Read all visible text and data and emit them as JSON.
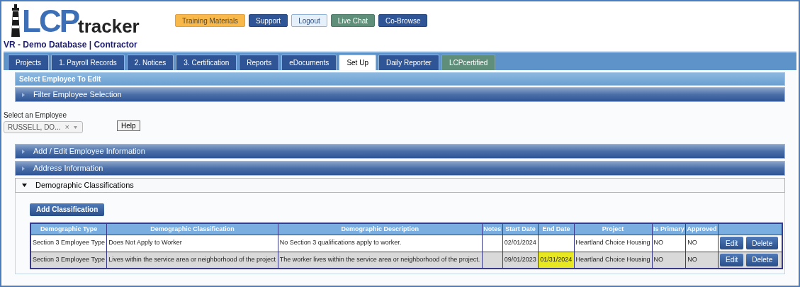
{
  "logo": {
    "mark": "LCP",
    "word": "tracker"
  },
  "subtitle": "VR - Demo Database | Contractor",
  "header_buttons": [
    {
      "label": "Training Materials",
      "kind": "training"
    },
    {
      "label": "Support",
      "kind": "primary"
    },
    {
      "label": "Logout",
      "kind": "light"
    },
    {
      "label": "Live Chat",
      "kind": "chat"
    },
    {
      "label": "Co-Browse",
      "kind": "primary"
    }
  ],
  "tabs": [
    {
      "label": "Projects",
      "selected": false,
      "kind": "normal"
    },
    {
      "label": "1. Payroll Records",
      "selected": false,
      "kind": "normal"
    },
    {
      "label": "2. Notices",
      "selected": false,
      "kind": "normal"
    },
    {
      "label": "3. Certification",
      "selected": false,
      "kind": "normal"
    },
    {
      "label": "Reports",
      "selected": false,
      "kind": "normal"
    },
    {
      "label": "eDocuments",
      "selected": false,
      "kind": "normal"
    },
    {
      "label": "Set Up",
      "selected": true,
      "kind": "normal"
    },
    {
      "label": "Daily Reporter",
      "selected": false,
      "kind": "normal"
    },
    {
      "label": "LCPcertified",
      "selected": false,
      "kind": "certified"
    }
  ],
  "panel_title": "Select Employee To Edit",
  "filter_section": {
    "title": "Filter Employee Selection",
    "expanded": false
  },
  "employee_select": {
    "label": "Select an Employee",
    "value": "RUSSELL, DO...",
    "clear": "×"
  },
  "help_button": "Help",
  "sections": [
    {
      "title": "Add / Edit Employee Information",
      "expanded": false
    },
    {
      "title": "Address Information",
      "expanded": false
    },
    {
      "title": "Demographic Classifications",
      "expanded": true
    }
  ],
  "add_button": "Add Classification",
  "table": {
    "columns": [
      "Demographic Type",
      "Demographic Classification",
      "Demographic Description",
      "Notes",
      "Start Date",
      "End Date",
      "Project",
      "Is Primary",
      "Approved"
    ],
    "rows": [
      {
        "cells": [
          "Section 3 Employee Type",
          "Does Not Apply to Worker",
          "No Section 3 qualifications apply to worker.",
          "",
          "02/01/2024",
          "",
          "Heartland Choice Housing",
          "NO",
          "NO"
        ],
        "end_date_highlighted": false,
        "actions": [
          "Edit",
          "Delete"
        ]
      },
      {
        "cells": [
          "Section 3 Employee Type",
          "Lives within the service area or neighborhood of the project",
          "The worker lives within the service area or neighborhood of the project.",
          "",
          "09/01/2023",
          "01/31/2024",
          "Heartland Choice Housing",
          "NO",
          "NO"
        ],
        "end_date_highlighted": true,
        "actions": [
          "Edit",
          "Delete"
        ]
      }
    ]
  }
}
